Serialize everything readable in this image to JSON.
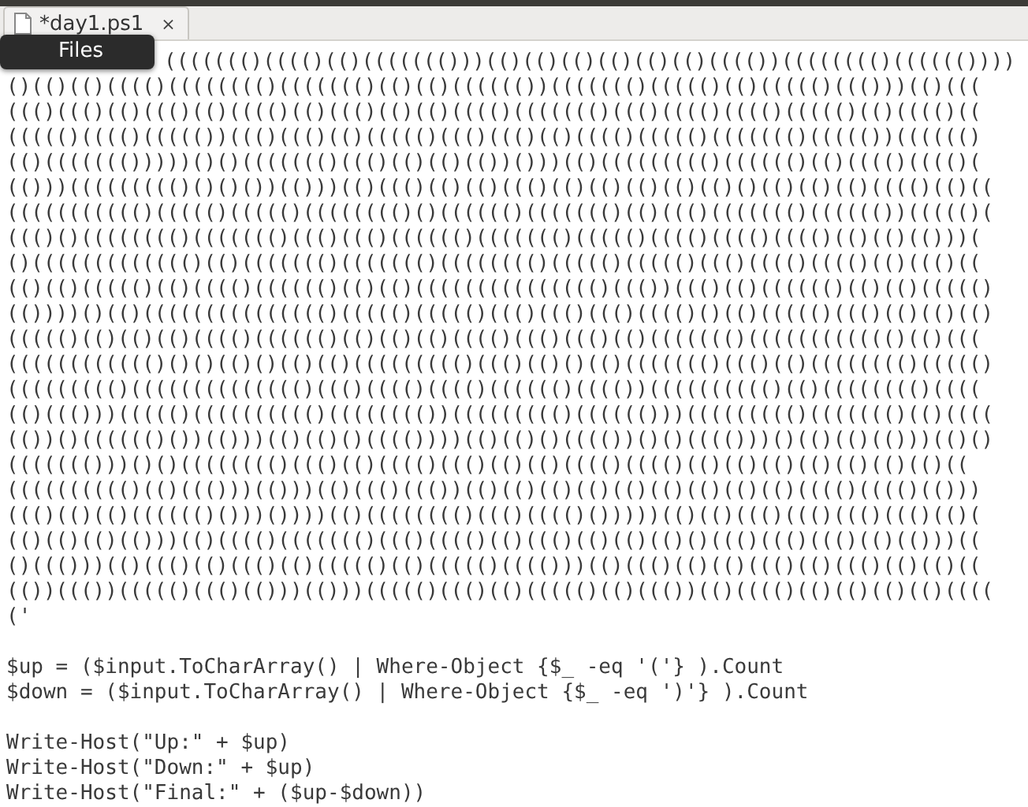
{
  "tab": {
    "title": "*day1.ps1",
    "close": "×"
  },
  "tooltip": {
    "text": "Files"
  },
  "covered_line": "((((((()(((()(()((((((()))(()(()(()(()(()(()(((())(((((((()(((((())))",
  "blocks": [
    [
      "()(()(()(((()(((((((()((((((()(()(()(((((())((((((()((((()(()((((()((()))(()(((",
      "((()((()(()((()(()(((()(()((()(()(()(((()((((((()((()(((()(((()((((()(()(((()((",
      "((((()(((()((((())((()((()(()((((()((()((()(()(((()((((()((((((()((((())(((((()",
      "(()((((((()))))()()((((((()((()(()(()(())()))(()((((((((()(((((()(()(((()(((()(",
      "(()))((((((((()()()())(()))(()((()(()(()((()(()(()(()(()(()()(()(()(()(((()(()((",
      "((((((((((()((((()((((()(((((((()()(((((()((((((()(()((()((((((()(((((())((((()(",
      "((()()(((((((()((((((()((()((()(((((()((((((()((((()(((()(((()(((()(()(()(()))(",
      "()((((((((((((()(()((((((()((((((()(((((((()((((()((((()((()(((()(((()(()((()((",
      "(()(()((((()(()(((()(((((()(()(()((((((((((((((()((())((()(()(((((()(()(()((((()",
      "(())))()(()((((((((((((((()((((()((((()((()((()((()(((()()(()((((()((()(()(()(()",
      "((((()(()(()(()(((()(((((()(()(()(()(((()((()((()(()((((((()(((((((((((()(()(((",
      "(((((((((((()()()(()()(()(()((((((((()((()(()()(()((((((()((()(()(((((((()((((()",
      "((((((((()(((((((((((((()((()(((()(((()(((((()(((())(((((((((()(()(((((((()((((",
      "(()((()))((((()(((((((((()(((((((())((((((((()(((((()))((((((((()((((((()(()((((",
      "(())()(((((()())(()))(()(()()(((())))(()(()()(((())()()(((()))()(()(()(()))(()()",
      "((((((()))()()(((((((()((()(()(((()((()(()(()(((()(((()(()(()(()(()(()(()(()((",
      "(((((((((()(()((()))(()))(()((()((())(()(()(()(()(()(()(()(()(()(((()(((()(()))",
      "((()(()(()(((((()()))())))(()(((((((()((()(((()()))))(()(()((()((()((()((()(()(",
      "(()(()(()(()))(()(((()((((((()((()(((()(()((()(()(()(()()((()((()((()(()(()))((",
      "()((()))(()((()(()((()(()((((()(()((((()(((()))(()((()(()(()((()(()((()(()(()((",
      "(())((())((((()((()(()))(()))((((()((()(()((((()(()((())(()(((()(()(()(()(()((((",
      "('"
    ],
    [
      "$up = ($input.ToCharArray() | Where-Object {$_ -eq '('} ).Count",
      "$down = ($input.ToCharArray() | Where-Object {$_ -eq ')'} ).Count"
    ],
    [
      "Write-Host(\"Up:\" + $up)",
      "Write-Host(\"Down:\" + $up)",
      "Write-Host(\"Final:\" + ($up-$down))"
    ]
  ]
}
